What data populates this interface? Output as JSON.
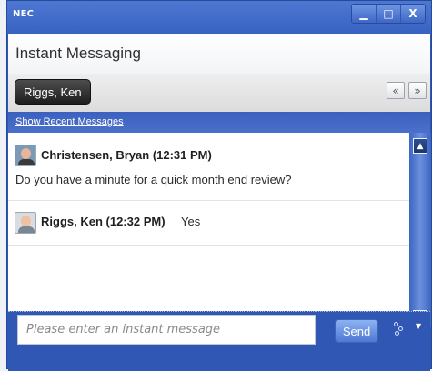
{
  "window": {
    "brand": "NEC",
    "controls": {
      "minimize": "▁",
      "maximize": "□",
      "close": "X"
    }
  },
  "header": {
    "title": "Instant Messaging"
  },
  "tabs": [
    {
      "label": "Riggs, Ken"
    }
  ],
  "nav": {
    "prev": "«",
    "next": "»"
  },
  "recent": {
    "link": "Show Recent Messages"
  },
  "messages": [
    {
      "sender": "Christensen, Bryan (12:31 PM)",
      "text": "Do you have a minute for a quick month end review?",
      "avatar": "christensen-bryan-avatar"
    },
    {
      "sender": "Riggs, Ken (12:32 PM)",
      "text": "Yes",
      "avatar": "riggs-ken-avatar"
    }
  ],
  "scroll": {
    "up": "▲",
    "down": "▼"
  },
  "composer": {
    "placeholder": "Please enter an instant message",
    "value": "",
    "send_label": "Send",
    "status_icon": "presence-icon",
    "caret": "▼"
  }
}
